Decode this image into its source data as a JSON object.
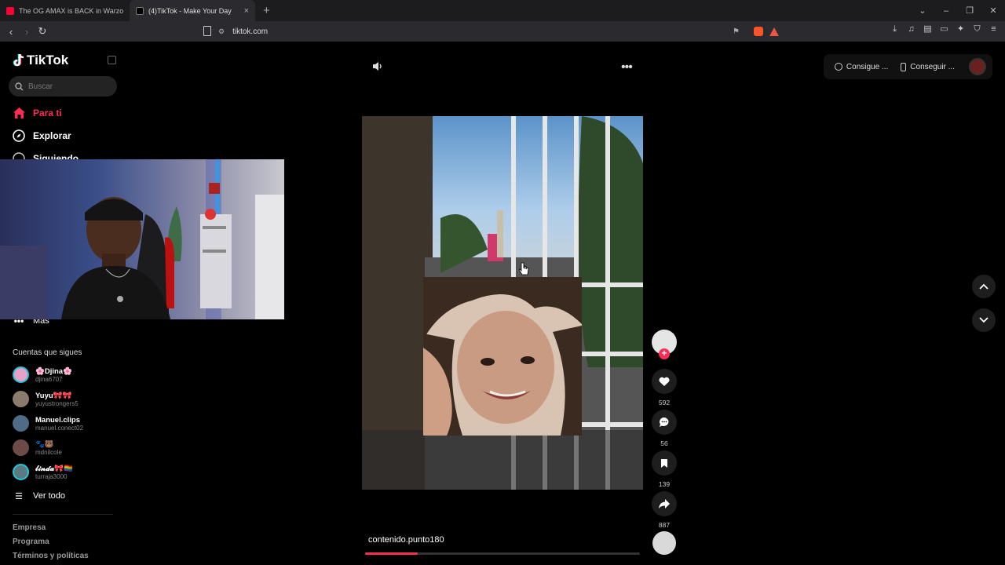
{
  "browser": {
    "tabs": [
      {
        "title": "The OG AMAX is BACK in Warzone 0 (",
        "favicon_color": "#ff0033"
      },
      {
        "title": "(4)TikTok - Make Your Day",
        "favicon_color": "#ffffff"
      }
    ],
    "url": "tiktok.com",
    "new_tab_glyph": "+",
    "close_glyph": "×"
  },
  "sidebar": {
    "logo": "TikTok",
    "search_placeholder": "Buscar",
    "nav": [
      {
        "label": "Para ti",
        "icon": "home-icon",
        "active": true
      },
      {
        "label": "Explorar",
        "icon": "compass-icon"
      },
      {
        "label": "Siguiendo",
        "icon": "following-icon"
      }
    ],
    "more_label": "Más",
    "following_title": "Cuentas que sigues",
    "accounts": [
      {
        "name": "🌸Djina🌸",
        "handle": "djina6707",
        "color": "#e7a0c6"
      },
      {
        "name": "Yuyu🎀🎀",
        "handle": "yuyustrongers5",
        "color": "#8a7b6c"
      },
      {
        "name": "Manuel.clips",
        "handle": "manuel.conect02",
        "color": "#4f6b86"
      },
      {
        "name": "🐾🐻",
        "handle": "mdnilcole",
        "color": "#6b4a48"
      },
      {
        "name": "𝓵𝓲𝓷𝓭𝓪🎀🏳️‍🌈",
        "handle": "turraja3000",
        "color": "#5a7b84"
      }
    ],
    "see_all": "Ver todo",
    "footer": [
      "Empresa",
      "Programa",
      "Términos y políticas"
    ]
  },
  "header": {
    "pill1": "Consigue ...",
    "pill2": "Conseguir ..."
  },
  "video": {
    "author": "contenido.punto180",
    "progress": 0.19
  },
  "actions": {
    "likes": "592",
    "comments": "56",
    "saves": "139",
    "shares": "887"
  },
  "colors": {
    "accent": "#fe2c55"
  }
}
